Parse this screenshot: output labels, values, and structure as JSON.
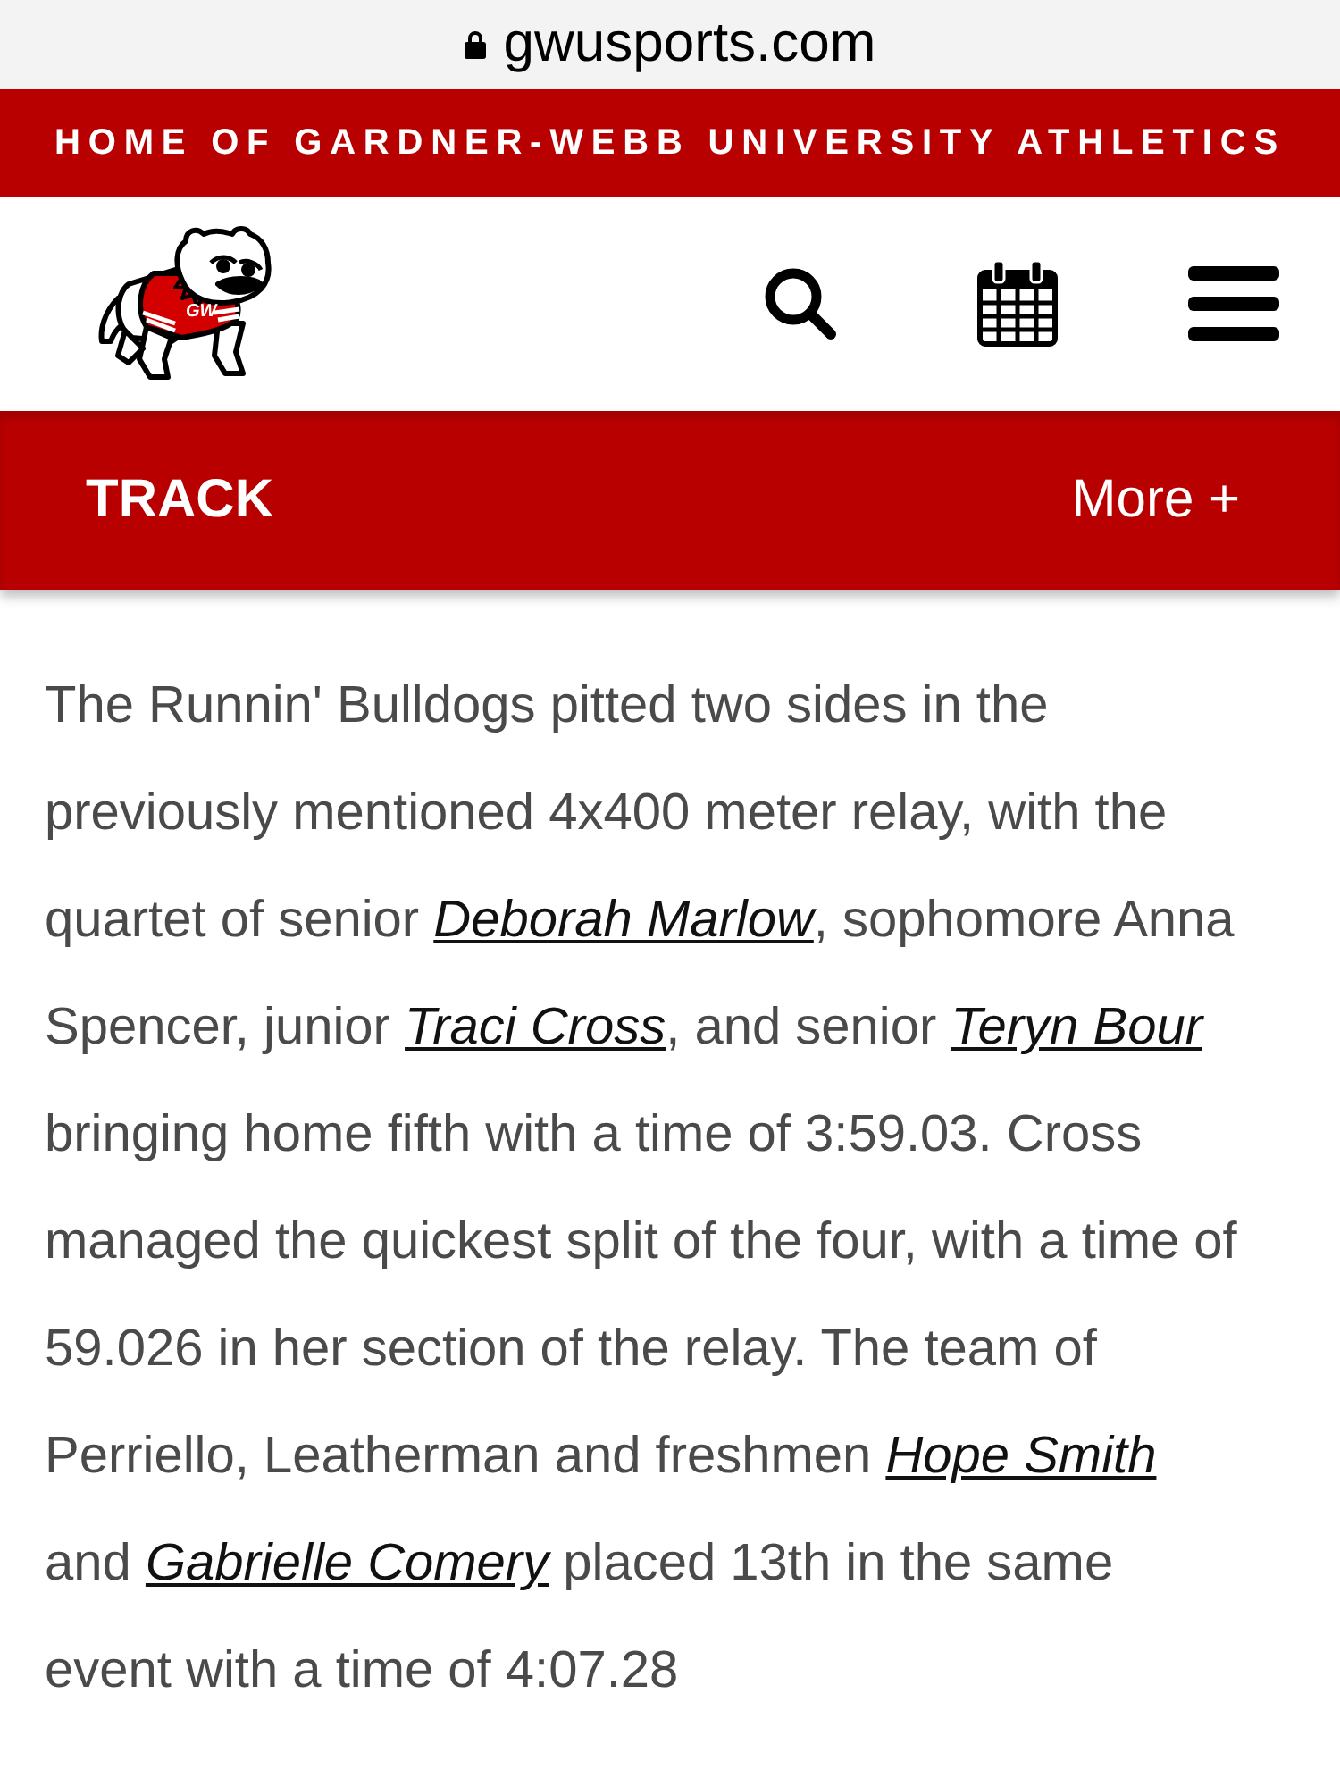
{
  "browser": {
    "url": "gwusports.com"
  },
  "banner": {
    "text": "HOME OF GARDNER-WEBB UNIVERSITY ATHLETICS"
  },
  "logo": {
    "jersey_text": "GW"
  },
  "section_bar": {
    "title": "TRACK",
    "more_label": "More +"
  },
  "article": {
    "segments": [
      {
        "kind": "text",
        "text": "The Runnin' Bulldogs pitted two sides in the previously mentioned 4x400 meter relay, with the quartet of senior "
      },
      {
        "kind": "link",
        "text": "Deborah Marlow"
      },
      {
        "kind": "text",
        "text": ", sophomore Anna Spencer, junior "
      },
      {
        "kind": "link",
        "text": "Traci Cross"
      },
      {
        "kind": "text",
        "text": ", and senior "
      },
      {
        "kind": "link",
        "text": "Teryn Bour"
      },
      {
        "kind": "text",
        "text": " bringing home fifth with a time of 3:59.03. Cross managed the quickest split of the four, with a time of 59.026 in her section of the relay. The team of Perriello, Leatherman and freshmen "
      },
      {
        "kind": "link",
        "text": "Hope Smith"
      },
      {
        "kind": "text",
        "text": " and "
      },
      {
        "kind": "link",
        "text": "Gabrielle Comery"
      },
      {
        "kind": "text",
        "text": " placed 13th in the same event with a time of 4:07.28"
      }
    ]
  }
}
